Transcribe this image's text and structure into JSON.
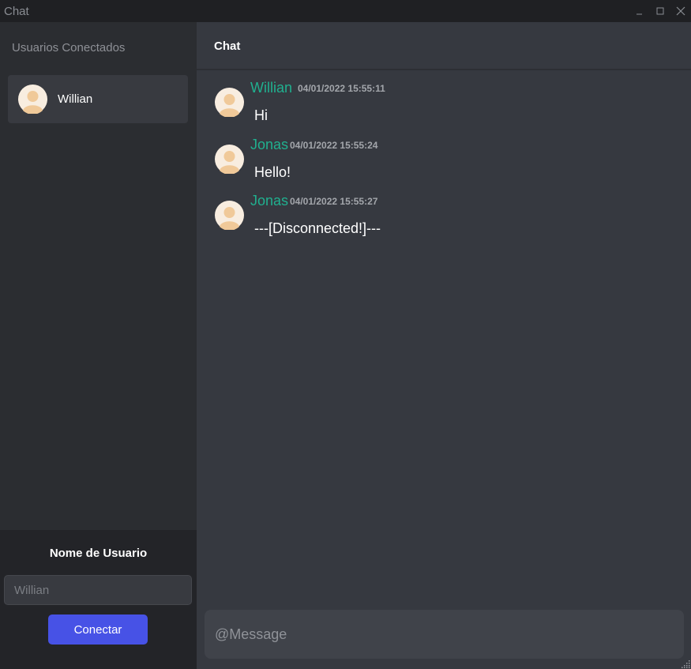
{
  "window": {
    "title": "Chat",
    "controls": [
      "minimize-icon",
      "maximize-icon",
      "close-icon"
    ]
  },
  "sidebar": {
    "title": "Usuarios Conectados",
    "users": [
      {
        "name": "Willian",
        "avatar": "user-avatar-icon"
      }
    ]
  },
  "login": {
    "label": "Nome de Usuario",
    "input_placeholder": "Willian",
    "input_value": "",
    "button_label": "Conectar"
  },
  "chat": {
    "header_title": "Chat",
    "messages": [
      {
        "author": "Willian",
        "timestamp": "04/01/2022 15:55:11",
        "text": "Hi"
      },
      {
        "author": "Jonas",
        "timestamp": "04/01/2022 15:55:24",
        "text": "Hello!"
      },
      {
        "author": "Jonas",
        "timestamp": "04/01/2022 15:55:27",
        "text": "---[Disconnected!]---"
      }
    ],
    "compose_placeholder": "@Message"
  },
  "colors": {
    "accent": "#4752e6",
    "author": "#20b08f",
    "sidebar_bg": "#2b2d31",
    "chat_bg": "#363940"
  }
}
